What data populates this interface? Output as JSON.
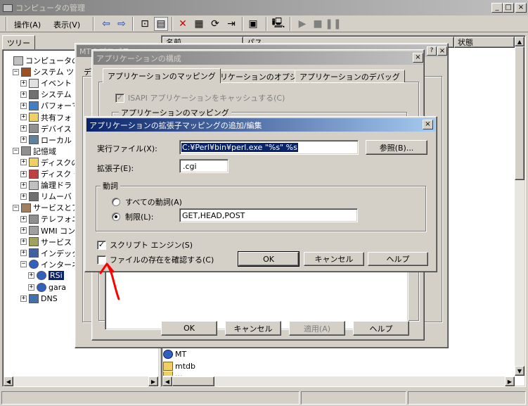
{
  "main_window": {
    "title": "コンピュータの管理",
    "menu": [
      "操作(A)",
      "表示(V)"
    ],
    "left_tab": "ツリー",
    "list_headers": [
      "名前",
      "パス",
      "状態"
    ],
    "list_items": [
      "MT",
      "mtdb",
      "..."
    ],
    "tree": [
      {
        "label": "コンピュータの管理",
        "level": 0
      },
      {
        "label": "システム ツー",
        "level": 1
      },
      {
        "label": "イベント",
        "level": 2
      },
      {
        "label": "システム",
        "level": 2
      },
      {
        "label": "パフォーマ",
        "level": 2
      },
      {
        "label": "共有フォ",
        "level": 2
      },
      {
        "label": "デバイス",
        "level": 2
      },
      {
        "label": "ローカル",
        "level": 2
      },
      {
        "label": "記憶域",
        "level": 1
      },
      {
        "label": "ディスクの",
        "level": 2
      },
      {
        "label": "ディスク デ",
        "level": 2
      },
      {
        "label": "論理ドラ",
        "level": 2
      },
      {
        "label": "リムーバ",
        "level": 2
      },
      {
        "label": "サービスとアプ",
        "level": 1
      },
      {
        "label": "テレフォニ",
        "level": 2
      },
      {
        "label": "WMI コン",
        "level": 2
      },
      {
        "label": "サービス",
        "level": 2
      },
      {
        "label": "インデック",
        "level": 2
      },
      {
        "label": "インターネ",
        "level": 2
      },
      {
        "label": "RSi",
        "level": 3
      },
      {
        "label": "gara",
        "level": 3
      },
      {
        "label": "DNS",
        "level": 2
      }
    ]
  },
  "props_window": {
    "title": "MTのプロパティ",
    "tab_partial": "ディ"
  },
  "config_dialog": {
    "title": "アプリケーションの構成",
    "tabs": [
      "アプリケーションのマッピング",
      "アプリケーションのオプション",
      "アプリケーションのデバッグ"
    ],
    "cache_isapi_label": "ISAPI アプリケーションをキャッシュする(C)",
    "mapping_group_label": "アプリケーションのマッピング",
    "buttons": {
      "ok": "OK",
      "cancel": "キャンセル",
      "apply": "適用(A)",
      "help": "ヘルプ"
    }
  },
  "ext_dialog": {
    "title": "アプリケーションの拡張子マッピングの追加/編集",
    "executable_label": "実行ファイル(X):",
    "executable_value": "C:¥Perl¥bin¥perl.exe \"%s\" %s",
    "browse_button": "参照(B)...",
    "extension_label": "拡張子(E):",
    "extension_value": ".cgi",
    "verbs_group": "動詞",
    "all_verbs_label": "すべての動詞(A)",
    "limit_label": "制限(L):",
    "limit_value": "GET,HEAD,POST",
    "script_engine_label": "スクリプト エンジン(S)",
    "script_engine_checked": true,
    "check_file_label": "ファイルの存在を確認する(C)",
    "check_file_checked": false,
    "buttons": {
      "ok": "OK",
      "cancel": "キャンセル",
      "help": "ヘルプ"
    }
  },
  "annotation": {
    "color": "#ff0000",
    "shape": "red-arrow"
  }
}
